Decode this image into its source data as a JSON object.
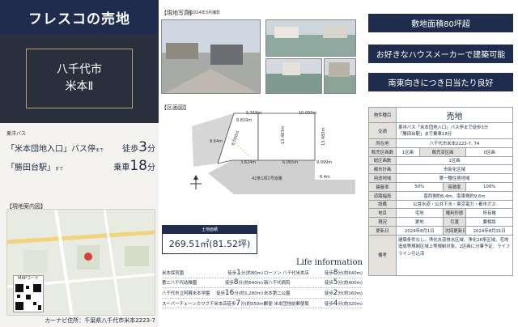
{
  "header": {
    "title": "フレスコの売地"
  },
  "property_name": {
    "line1": "八千代市",
    "line2": "米本Ⅱ"
  },
  "access": {
    "bus_label": "東洋バス",
    "stop_name": "「米本団地入口」バス停",
    "stop_suffix": "まで",
    "walk_label": "徒歩",
    "walk_value": "3",
    "walk_unit": "分",
    "station_name": "「勝田台駅」",
    "station_suffix": "まで",
    "ride_label": "乗車",
    "ride_value": "18",
    "ride_unit": "分"
  },
  "map": {
    "label": "【現地案内図】",
    "qr_label": "MAPコード"
  },
  "footer_address": "カーナビ住所：千葉県八千代市米本2223-7",
  "photos": {
    "label": "【現地写真】",
    "note": "※2024年3月撮影"
  },
  "plan": {
    "label": "【区画図】",
    "dims": [
      "5.319m",
      "10.000m",
      "8.819m",
      "8.500m",
      "13.483m",
      "13.483m",
      "6.065m",
      "9.999m",
      "3.824m",
      "6.4m",
      "8.64m"
    ],
    "road_label": "42条1項1号道路",
    "area_label": "土地面積",
    "area_value": "269.51㎡(81.52坪)"
  },
  "life_info": {
    "title": "Life information",
    "left": [
      {
        "name": "米本保育園",
        "walk": "徒歩",
        "min": "1",
        "dist": "分(約80m)"
      },
      {
        "name": "第二八千代幼稚園",
        "walk": "徒歩",
        "min": "8",
        "dist": "分(約640m)"
      },
      {
        "name": "八千代市立阿蘇米本学園",
        "walk": "徒歩",
        "min": "16",
        "dist": "分(約1,280m)"
      },
      {
        "name": "スーパーチェーンカワグチ米本店",
        "walk": "徒歩",
        "min": "7",
        "dist": "分(約550m)"
      }
    ],
    "right": [
      {
        "name": "ローソン 八千代米本店",
        "walk": "徒歩",
        "min": "8",
        "dist": "分(約640m)"
      },
      {
        "name": "新八千代病院",
        "walk": "徒歩",
        "min": "5",
        "dist": "分(約400m)"
      },
      {
        "name": "米本第二公園",
        "walk": "徒歩",
        "min": "2",
        "dist": "分(約160m)"
      },
      {
        "name": "郵便 米本団地前郵便局",
        "walk": "徒歩",
        "min": "4",
        "dist": "分(約320m)"
      }
    ]
  },
  "features": [
    "敷地面積80坪超",
    "お好きなハウスメーカーで建築可能",
    "南東向きにつき日当たり良好"
  ],
  "spec": {
    "type_label": "物件種目",
    "type_value": "売地",
    "traffic_label": "交通",
    "traffic_value_1": "東洋バス「米本団地入口」バス停まで徒歩3分",
    "traffic_value_2": "「勝田台駅」まで乗車18分",
    "location_label": "所在地",
    "location_value": "八千代市米本2223-7, 74",
    "sections_label": "販売区画数",
    "sections_value": "1区画",
    "sections_mid_label": "販売済区画",
    "sections_mid_value": "0区画",
    "sections_total_label": "総区画数",
    "sections_total_value": "1区画",
    "city_plan_label": "都市計画",
    "city_plan_value": "市街化区域",
    "zoning_label": "用途地域",
    "zoning_value": "第一種住居地域",
    "coverage_label": "建蔽率",
    "coverage_value": "50%",
    "far_label": "容積率",
    "far_value": "100%",
    "road_label": "道路幅員",
    "road_value": "南西側約6.4m、南東側約9.6m",
    "utilities_label": "設備",
    "utilities_value": "公営水道・公共下水・東京電力・都市ガス",
    "land_label": "地目",
    "land_value": "宅地",
    "rights_label": "権利形態",
    "rights_value": "所有権",
    "status_label": "現況",
    "status_value": "更地",
    "handover_label": "引渡",
    "handover_value": "要相談",
    "updated_label": "更新日",
    "updated_value": "2024年8月1日",
    "next_update_label": "次回更新日",
    "next_update_value": "2024年8月31日",
    "remarks_label": "備考",
    "remarks_value": "建築条件なし。浄化水道排水区域、浄化26条区域。宅地造成等規制区域上等規制対象。2区画に分筆予定、ライフライン引込済"
  }
}
